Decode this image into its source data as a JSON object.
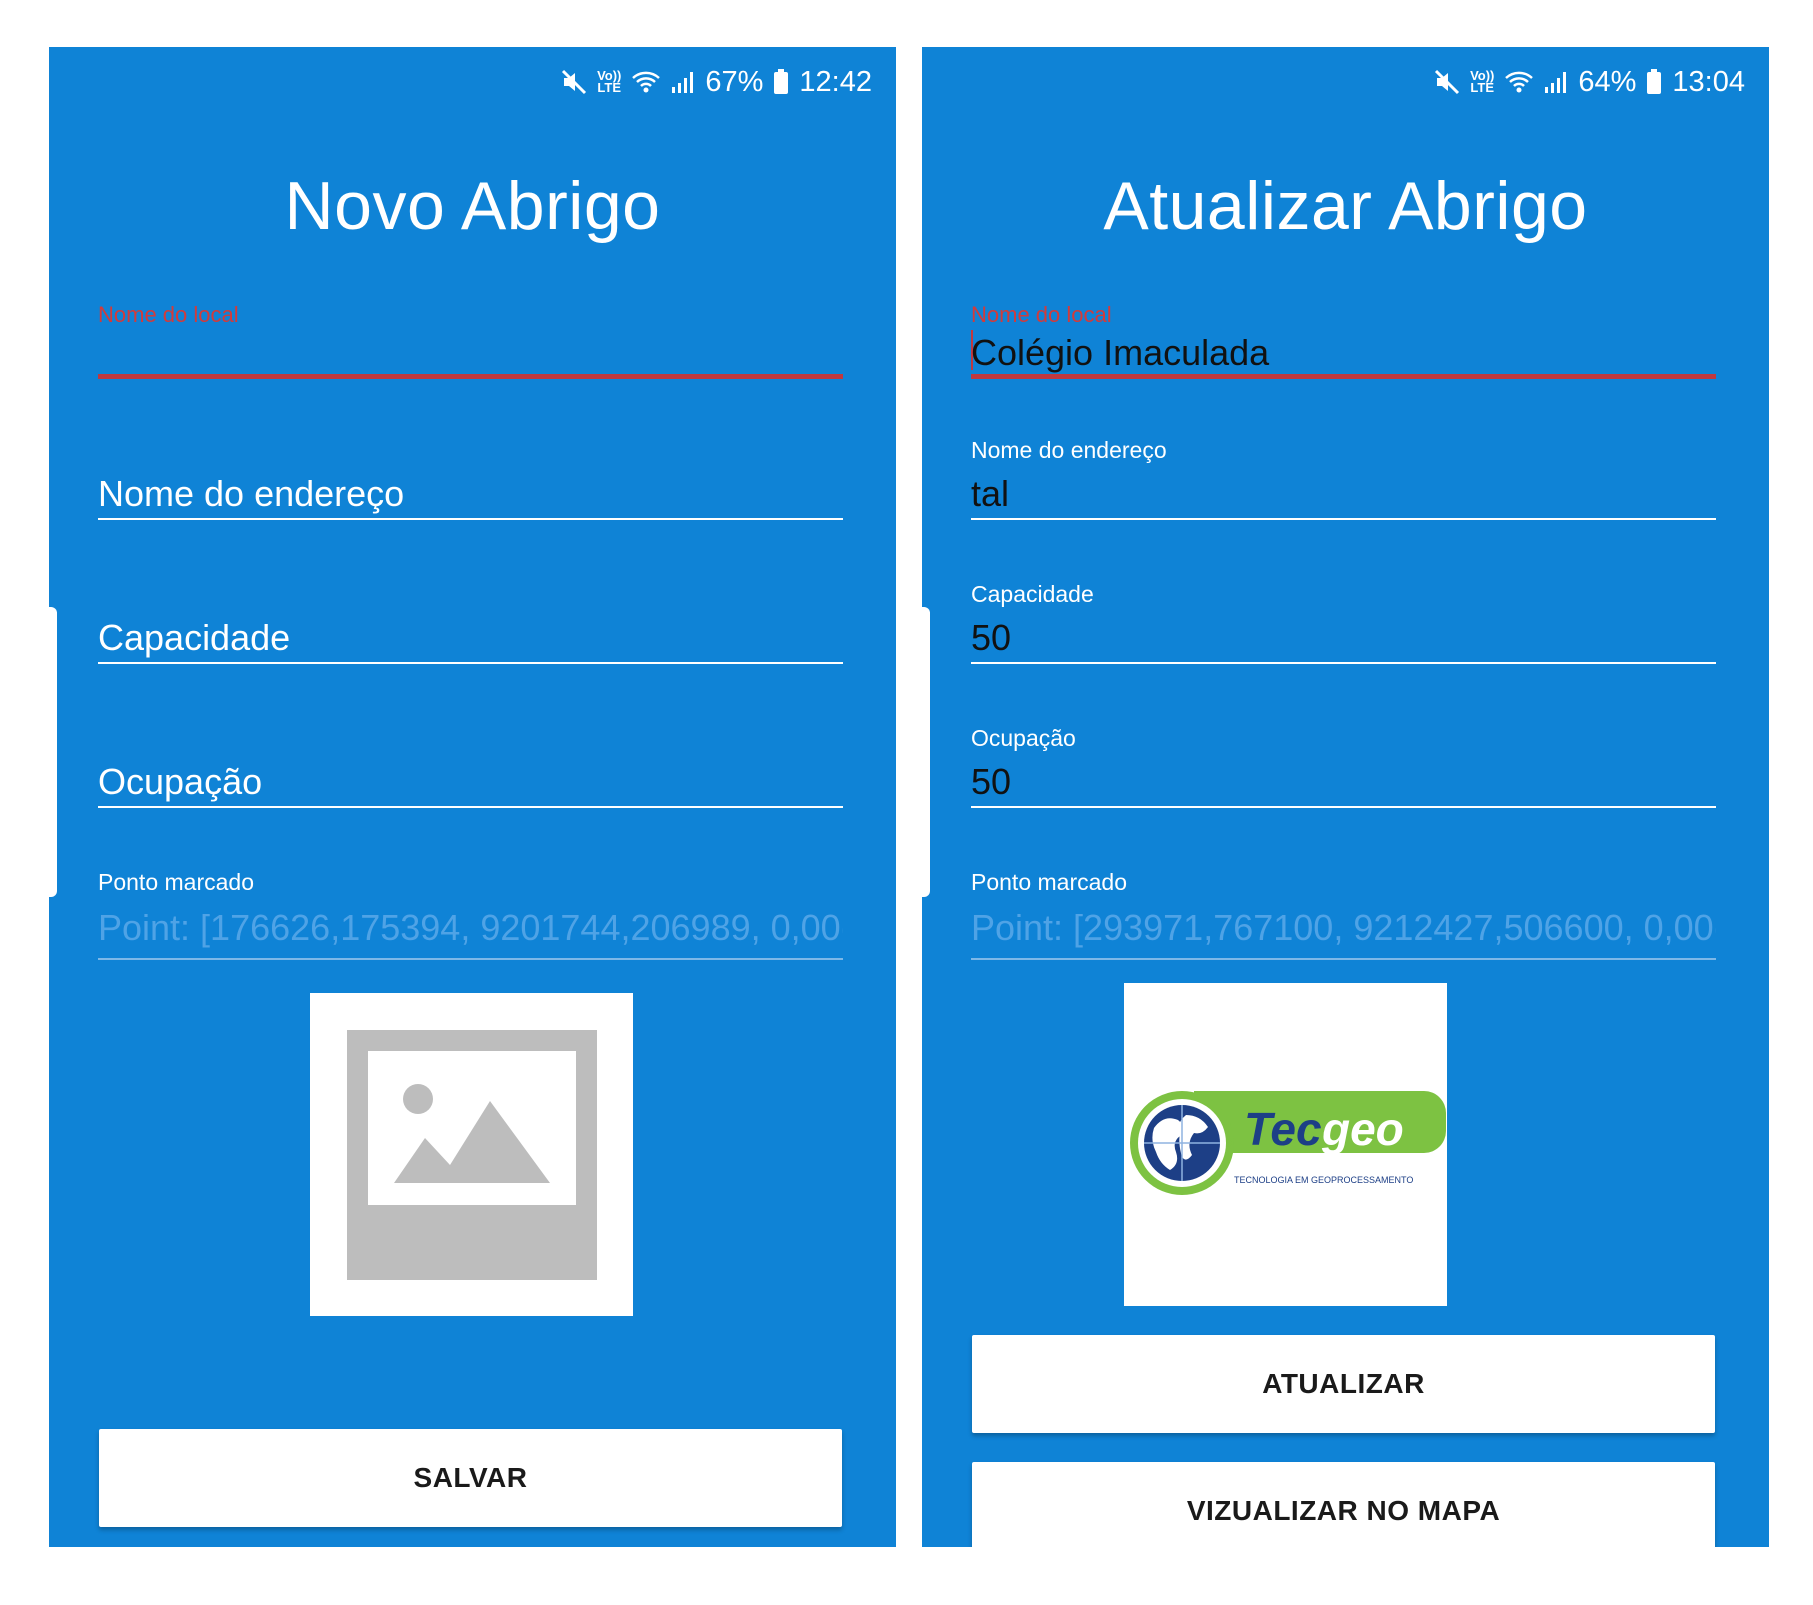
{
  "left_screen": {
    "status": {
      "battery_pct": "67%",
      "time": "12:42",
      "lte_top": "Vo))",
      "lte_bottom": "LTE"
    },
    "title": "Novo Abrigo",
    "fields": {
      "nome_local_label": "Nome do local",
      "nome_endereco_placeholder": "Nome do endereço",
      "capacidade_placeholder": "Capacidade",
      "ocupacao_placeholder": "Ocupação",
      "ponto_label": "Ponto marcado",
      "ponto_value": "Point: [176626,175394, 9201744,206989, 0,00("
    },
    "image_icon": "image-placeholder-icon",
    "save_button": "SALVAR"
  },
  "right_screen": {
    "status": {
      "battery_pct": "64%",
      "time": "13:04",
      "lte_top": "Vo))",
      "lte_bottom": "LTE"
    },
    "title": "Atualizar Abrigo",
    "fields": {
      "nome_local_label": "Nome do local",
      "nome_local_value": "Colégio Imaculada",
      "nome_endereco_label": "Nome do endereço",
      "nome_endereco_value": "tal",
      "capacidade_label": "Capacidade",
      "capacidade_value": "50",
      "ocupacao_label": "Ocupação",
      "ocupacao_value": "50",
      "ponto_label": "Ponto marcado",
      "ponto_value": "Point: [293971,767100, 9212427,506600, 0,00("
    },
    "logo": {
      "text": "Tecgeo",
      "tagline": "TECNOLOGIA EM GEOPROCESSAMENTO"
    },
    "update_button": "ATUALIZAR",
    "map_button": "VIZUALIZAR NO MAPA"
  },
  "colors": {
    "background_blue": "#0f83d6",
    "error_red": "#c0383f",
    "logo_green": "#7dc242",
    "logo_navy": "#1d3f86"
  }
}
